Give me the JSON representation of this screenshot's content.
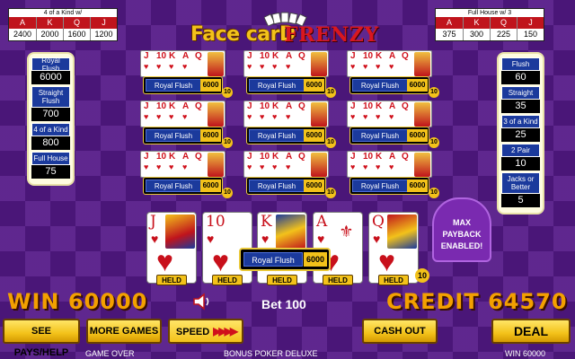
{
  "top_left": {
    "title": "4 of a Kind w/",
    "headers": [
      "A",
      "K",
      "Q",
      "J"
    ],
    "values": [
      "2400",
      "2000",
      "1600",
      "1200"
    ]
  },
  "top_right": {
    "title": "Full House w/ 3",
    "headers": [
      "A",
      "K",
      "Q",
      "J"
    ],
    "values": [
      "375",
      "300",
      "225",
      "150"
    ]
  },
  "logo": {
    "part1": "Face carD",
    "part2": "FRENZY"
  },
  "left_paytable": [
    {
      "label": "Royal Flush",
      "value": "6000"
    },
    {
      "label": "Straight Flush",
      "value": "700"
    },
    {
      "label": "4 of a Kind",
      "value": "800"
    },
    {
      "label": "Full House",
      "value": "75"
    }
  ],
  "right_paytable": [
    {
      "label": "Flush",
      "value": "60"
    },
    {
      "label": "Straight",
      "value": "35"
    },
    {
      "label": "3 of a Kind",
      "value": "25"
    },
    {
      "label": "2 Pair",
      "value": "10"
    },
    {
      "label": "Jacks or Better",
      "value": "5"
    }
  ],
  "mini_hand": {
    "ranks": [
      "J",
      "10",
      "K",
      "A",
      "Q"
    ],
    "suit": "♥",
    "result": "Royal Flush",
    "payout": "6000",
    "multiplier": "10"
  },
  "main_hand": {
    "cards": [
      {
        "rank": "J",
        "suit": "♥"
      },
      {
        "rank": "10",
        "suit": "♥"
      },
      {
        "rank": "K",
        "suit": "♥"
      },
      {
        "rank": "A",
        "suit": "♥"
      },
      {
        "rank": "Q",
        "suit": "♥"
      }
    ],
    "held_label": "HELD",
    "result": "Royal Flush",
    "payout": "6000",
    "multiplier": "10"
  },
  "max_payback": "MAX PAYBACK ENABLED!",
  "win": "WIN 60000",
  "bet": "Bet 100",
  "credit": "CREDIT 64570",
  "buttons": {
    "see_pays": "SEE PAYS/HELP",
    "more_games": "MORE GAMES",
    "speed": "SPEED",
    "cash_out": "CASH OUT",
    "deal": "DEAL"
  },
  "status": {
    "left": "GAME OVER",
    "center": "BONUS POKER DELUXE",
    "right": "WIN 60000"
  },
  "colors": {
    "background": "#4a1678",
    "accent_gold": "#f3c21a",
    "paytable_blue": "#1b3a9c",
    "card_red": "#c8101b"
  }
}
